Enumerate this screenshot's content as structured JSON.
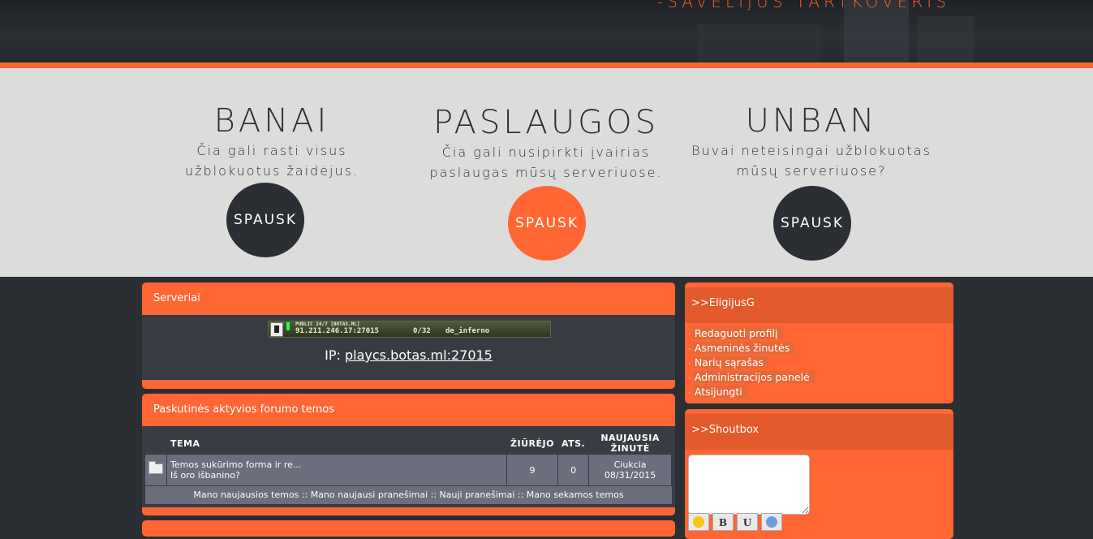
{
  "header": {
    "quote": "-SAVELIJUS TARTKOVERIS"
  },
  "features": [
    {
      "title": "BANAI",
      "line1": "Čia gali rasti visus",
      "line2": "užblokuotus žaidėjus.",
      "button": "SPAUSK"
    },
    {
      "title": "PASLAUGOS",
      "line1": "Čia gali nusipirkti įvairias",
      "line2": "paslaugas mūsų serveriuose.",
      "button": "SPAUSK"
    },
    {
      "title": "UNBAN",
      "line1": "Buvai neteisingai užblokuotas",
      "line2": "mūsų serveriuose?",
      "button": "SPAUSK"
    }
  ],
  "servers": {
    "title": "Serveriai",
    "banner": {
      "name": "PUBLIC 24/7 [BOTAS.ML]",
      "address": "91.211.246.17:27015",
      "players": "0/32",
      "map": "de_inferno"
    },
    "ip_label": "IP:",
    "ip_link": "playcs.botas.ml:27015"
  },
  "forum": {
    "title": "Paskutinės aktyvios forumo temos",
    "columns": [
      "TEMA",
      "ŽIŪRĖJO",
      "ATS.",
      "NAUJAUSIA ŽINUTĖ"
    ],
    "rows": [
      {
        "topic": "Temos sukūrimo forma ir re...",
        "subtitle": "Iš oro išbanino?",
        "views": "9",
        "replies": "0",
        "last_author": "Ciukcia",
        "last_date": "08/31/2015"
      }
    ],
    "footer": "Mano naujausios temos :: Mano naujausi pranešimai :: Nauji pranešimai :: Mano sekamos temos"
  },
  "user_panel": {
    "title": ">>EligijusG",
    "links": [
      "Redaguoti profilį",
      "Asmeninės žinutės",
      "Narių sąrašas",
      "Administracijos panelė",
      "Atsijungti"
    ]
  },
  "shoutbox": {
    "title": ">>Shoutbox",
    "buttons": [
      "B",
      "U"
    ]
  },
  "colors": {
    "accent": "#ff6633",
    "dark": "#2b2e33",
    "band": "#dcdddb"
  }
}
